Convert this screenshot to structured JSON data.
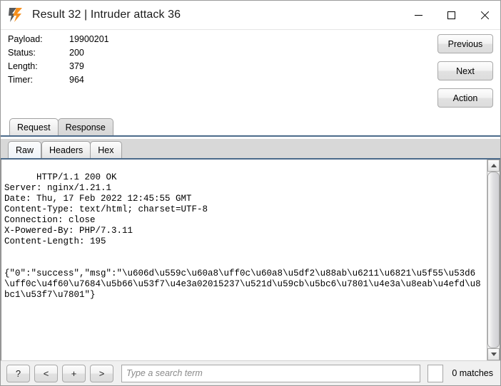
{
  "window": {
    "title": "Result 32 | Intruder attack 36",
    "logo_icon": "burp-suite-logo",
    "controls": {
      "minimize": "minimize-icon",
      "maximize": "maximize-icon",
      "close": "close-icon"
    }
  },
  "info": {
    "rows": [
      {
        "label": "Payload:",
        "value": "19900201"
      },
      {
        "label": "Status:",
        "value": "200"
      },
      {
        "label": "Length:",
        "value": "379"
      },
      {
        "label": "Timer:",
        "value": "964"
      }
    ]
  },
  "actions": {
    "previous": "Previous",
    "next": "Next",
    "action": "Action"
  },
  "outer_tabs": [
    {
      "label": "Request",
      "selected": false
    },
    {
      "label": "Response",
      "selected": true
    }
  ],
  "inner_tabs": [
    {
      "label": "Raw",
      "selected": true
    },
    {
      "label": "Headers",
      "selected": false
    },
    {
      "label": "Hex",
      "selected": false
    }
  ],
  "response": {
    "headers": "HTTP/1.1 200 OK\nServer: nginx/1.21.1\nDate: Thu, 17 Feb 2022 12:45:55 GMT\nContent-Type: text/html; charset=UTF-8\nConnection: close\nX-Powered-By: PHP/7.3.11\nContent-Length: 195",
    "body": "{\"0\":\"success\",\"msg\":\"\\u606d\\u559c\\u60a8\\uff0c\\u60a8\\u5df2\\u88ab\\u6211\\u6821\\u5f55\\u53d6\\uff0c\\u4f60\\u7684\\u5b66\\u53f7\\u4e3a02015237\\u521d\\u59cb\\u5bc6\\u7801\\u4e3a\\u8eab\\u4efd\\u8bc1\\u53f7\\u7801\"}"
  },
  "search": {
    "help_label": "?",
    "prev_label": "<",
    "add_label": "+",
    "next_label": ">",
    "placeholder": "Type a search term",
    "value": "",
    "matches": "0 matches"
  },
  "scrollbar": {
    "up_icon": "scroll-up-arrow-icon",
    "down_icon": "scroll-down-arrow-icon"
  },
  "colors": {
    "accent_orange": "#f7901e",
    "logo_gray": "#58595b",
    "tab_underline": "#4b6a8a"
  }
}
